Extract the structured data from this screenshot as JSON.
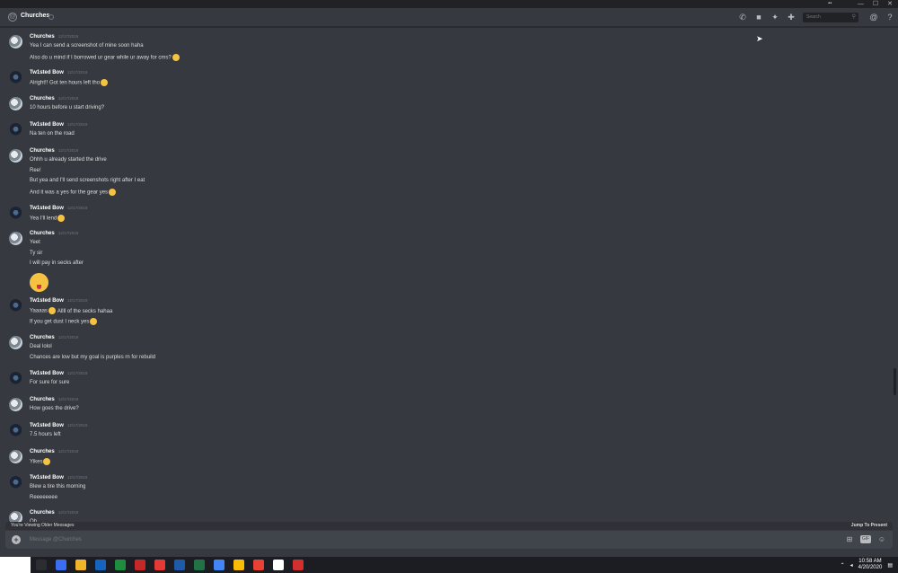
{
  "window": {
    "minimize": "—",
    "maximize": "☐",
    "close": "✕",
    "logo": "▪▪"
  },
  "header": {
    "channel_name": "Churches",
    "at_symbol": "@",
    "search_placeholder": "Search",
    "icons": [
      "phone-call-icon",
      "video-icon",
      "pin-icon",
      "add-friend-icon",
      "mention-icon",
      "help-icon"
    ]
  },
  "messages": [
    {
      "author": "Churches",
      "avatar": "church",
      "timestamp": "12/17/2019",
      "lines": [
        {
          "text": "Yea I can send a screenshot of mine soon haha"
        },
        {
          "text": "Also do u mind if I borrowed ur gear while ur away for cms?",
          "emoji": true
        }
      ]
    },
    {
      "author": "Tw1sted Bow",
      "avatar": "twisted",
      "timestamp": "12/17/2019",
      "lines": [
        {
          "text": "Alright!! Got ten hours left tho",
          "emoji": true
        }
      ]
    },
    {
      "author": "Churches",
      "avatar": "church",
      "timestamp": "12/17/2019",
      "lines": [
        {
          "text": "10 hours before u start driving?"
        }
      ]
    },
    {
      "author": "Tw1sted Bow",
      "avatar": "twisted",
      "timestamp": "12/17/2019",
      "lines": [
        {
          "text": "Na ten on the road"
        }
      ]
    },
    {
      "author": "Churches",
      "avatar": "church",
      "timestamp": "12/17/2019",
      "lines": [
        {
          "text": "Ohhh u already started the drive"
        },
        {
          "text": "Ree!"
        },
        {
          "text": "But yea and I'll send screenshots right after I eat"
        },
        {
          "text": "And it was a yes for the gear yes",
          "emoji": true
        }
      ]
    },
    {
      "author": "Tw1sted Bow",
      "avatar": "twisted",
      "timestamp": "12/17/2019",
      "lines": [
        {
          "text": "Yea I'll lend",
          "emoji": true
        }
      ]
    },
    {
      "author": "Churches",
      "avatar": "church",
      "timestamp": "12/17/2019",
      "lines": [
        {
          "text": "Yeet"
        },
        {
          "text": "Ty sir"
        },
        {
          "text": "I will pay in secks after"
        }
      ],
      "big_emoji": true
    },
    {
      "author": "Tw1sted Bow",
      "avatar": "twisted",
      "timestamp": "12/17/2019",
      "lines": [
        {
          "text": "Yaaaas",
          "emoji": true,
          "after": "Allll of the secks hahaa"
        },
        {
          "text": "If you get dust I neck yes",
          "emoji": true
        }
      ]
    },
    {
      "author": "Churches",
      "avatar": "church",
      "timestamp": "12/17/2019",
      "lines": [
        {
          "text": "Deal lolol"
        },
        {
          "text": "Chances are low but my goal is purples rn for rebuild"
        }
      ]
    },
    {
      "author": "Tw1sted Bow",
      "avatar": "twisted",
      "timestamp": "12/17/2019",
      "lines": [
        {
          "text": "For sure for sure"
        }
      ]
    },
    {
      "author": "Churches",
      "avatar": "church",
      "timestamp": "12/17/2019",
      "lines": [
        {
          "text": "How goes the drive?"
        }
      ]
    },
    {
      "author": "Tw1sted Bow",
      "avatar": "twisted",
      "timestamp": "12/17/2019",
      "lines": [
        {
          "text": "7.5 hours left"
        }
      ]
    },
    {
      "author": "Churches",
      "avatar": "church",
      "timestamp": "12/17/2019",
      "lines": [
        {
          "text": "Yikes",
          "emoji": true
        }
      ]
    },
    {
      "author": "Tw1sted Bow",
      "avatar": "twisted",
      "timestamp": "12/17/2019",
      "lines": [
        {
          "text": "Blew a tire this morning"
        },
        {
          "text": "Reeeeeeee"
        }
      ]
    },
    {
      "author": "Churches",
      "avatar": "church",
      "timestamp": "12/17/2019",
      "lines": [
        {
          "text": "Oh"
        }
      ]
    }
  ],
  "older_bar": {
    "left": "You're Viewing Older Messages",
    "right": "Jump To Present"
  },
  "composer": {
    "placeholder": "Message @Churches",
    "plus": "+"
  },
  "taskbar": {
    "time": "10:58 AM",
    "date": "4/20/2020",
    "icons": [
      "windows-start",
      "task-view-icon",
      "chrome-icon",
      "file-explorer-icon",
      "outlook-icon",
      "excel-icon",
      "access-icon",
      "acrobat-icon",
      "word-icon",
      "excel-icon-2",
      "chrome-icon-2",
      "chrome-icon-3",
      "snip-icon",
      "settings-icon",
      "app-icon"
    ],
    "icon_colors": [
      "#2b2d31",
      "#3a6df0",
      "#f0b429",
      "#1565c0",
      "#1e8e3e",
      "#c62828",
      "#e53935",
      "#1e5aa8",
      "#217346",
      "#4285f4",
      "#fbbc05",
      "#e94235",
      "#ffffff",
      "#d32f2f"
    ]
  }
}
